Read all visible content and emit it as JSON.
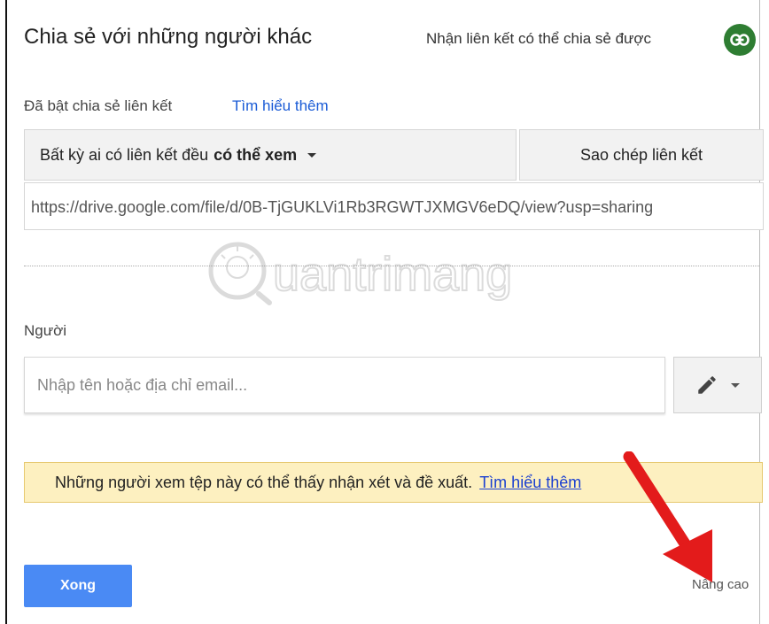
{
  "dialog": {
    "title": "Chia sẻ với những người khác",
    "shareable_link_label": "Nhận liên kết có thể chia sẻ được"
  },
  "link_sharing": {
    "status": "Đã bật chia sẻ liên kết",
    "learn_more": "Tìm hiểu thêm",
    "permission_normal": "Bất kỳ ai có liên kết đều",
    "permission_bold": "có thể xem",
    "copy_label": "Sao chép liên kết",
    "url": "https://drive.google.com/file/d/0B-TjGUKLVi1Rb3RGWTJXMGV6eDQ/view?usp=sharing"
  },
  "people": {
    "label": "Người",
    "placeholder": "Nhập tên hoặc địa chỉ email..."
  },
  "notice": {
    "text": "Những người xem tệp này có thể thấy nhận xét và đề xuất.",
    "link": "Tìm hiểu thêm"
  },
  "footer": {
    "done_label": "Xong",
    "advanced_label": "Nâng cao"
  },
  "colors": {
    "accent_blue": "#4a8af4",
    "link_blue": "#1a5bd6",
    "green_link_icon": "#2e7d32",
    "notice_bg": "#fdf0c0",
    "arrow_red": "#e31b1b"
  },
  "icons": {
    "link": "link-icon",
    "pencil": "pencil-icon",
    "dropdown": "chevron-down-icon"
  },
  "watermark": {
    "text": "uantrimang"
  }
}
